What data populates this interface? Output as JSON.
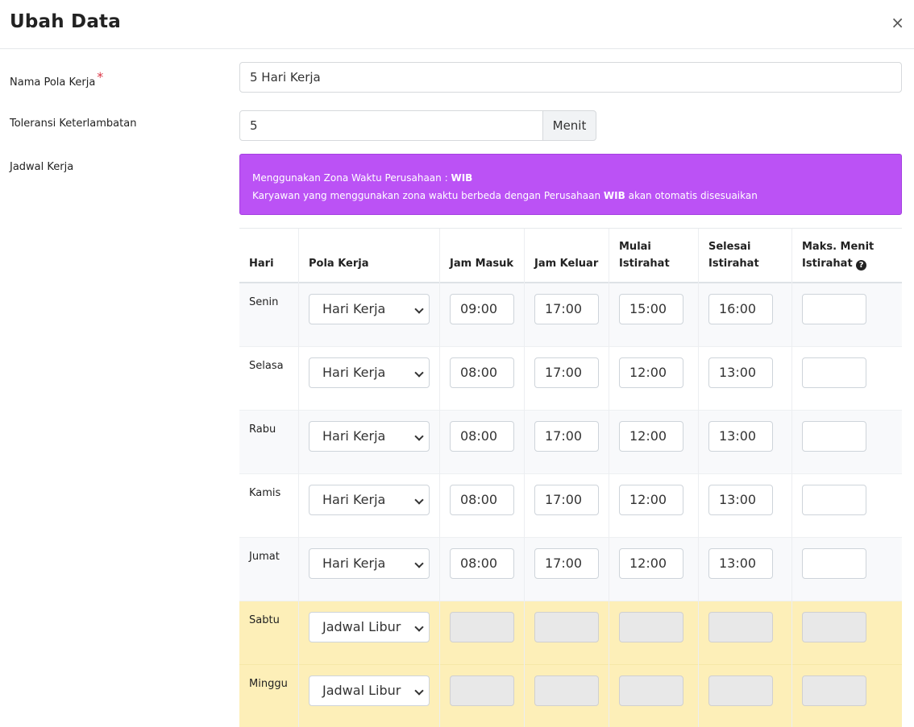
{
  "modal": {
    "title": "Ubah Data",
    "close_symbol": "×"
  },
  "form": {
    "nama_label": "Nama Pola Kerja",
    "required_mark": "*",
    "nama_value": "5 Hari Kerja",
    "toleransi_label": "Toleransi Keterlambatan",
    "toleransi_value": "5",
    "toleransi_unit": "Menit",
    "jadwal_label": "Jadwal Kerja"
  },
  "alert": {
    "line1_prefix": "Menggunakan Zona Waktu Perusahaan : ",
    "line1_zone": "WIB",
    "line2_prefix": "Karyawan yang menggunakan zona waktu berbeda dengan Perusahaan ",
    "line2_zone": "WIB",
    "line2_suffix": " akan otomatis disesuaikan",
    "color": "#bb52f5"
  },
  "table": {
    "headers": {
      "hari": "Hari",
      "pola": "Pola Kerja",
      "masuk": "Jam Masuk",
      "keluar": "Jam Keluar",
      "mulai_1": "Mulai",
      "mulai_2": "Istirahat",
      "selesai_1": "Selesai",
      "selesai_2": "Istirahat",
      "maks_1": "Maks. Menit",
      "maks_2": "Istirahat",
      "help_icon": "?"
    },
    "rows": [
      {
        "day": "Senin",
        "pola": "Hari Kerja",
        "masuk": "09:00",
        "keluar": "17:00",
        "mulai": "15:00",
        "selesai": "16:00",
        "maks": ""
      },
      {
        "day": "Selasa",
        "pola": "Hari Kerja",
        "masuk": "08:00",
        "keluar": "17:00",
        "mulai": "12:00",
        "selesai": "13:00",
        "maks": ""
      },
      {
        "day": "Rabu",
        "pola": "Hari Kerja",
        "masuk": "08:00",
        "keluar": "17:00",
        "mulai": "12:00",
        "selesai": "13:00",
        "maks": ""
      },
      {
        "day": "Kamis",
        "pola": "Hari Kerja",
        "masuk": "08:00",
        "keluar": "17:00",
        "mulai": "12:00",
        "selesai": "13:00",
        "maks": ""
      },
      {
        "day": "Jumat",
        "pola": "Hari Kerja",
        "masuk": "08:00",
        "keluar": "17:00",
        "mulai": "12:00",
        "selesai": "13:00",
        "maks": ""
      },
      {
        "day": "Sabtu",
        "pola": "Jadwal Libur",
        "masuk": "",
        "keluar": "",
        "mulai": "",
        "selesai": "",
        "maks": ""
      },
      {
        "day": "Minggu",
        "pola": "Jadwal Libur",
        "masuk": "",
        "keluar": "",
        "mulai": "",
        "selesai": "",
        "maks": ""
      }
    ],
    "off_row_color": "#fdefb8"
  }
}
